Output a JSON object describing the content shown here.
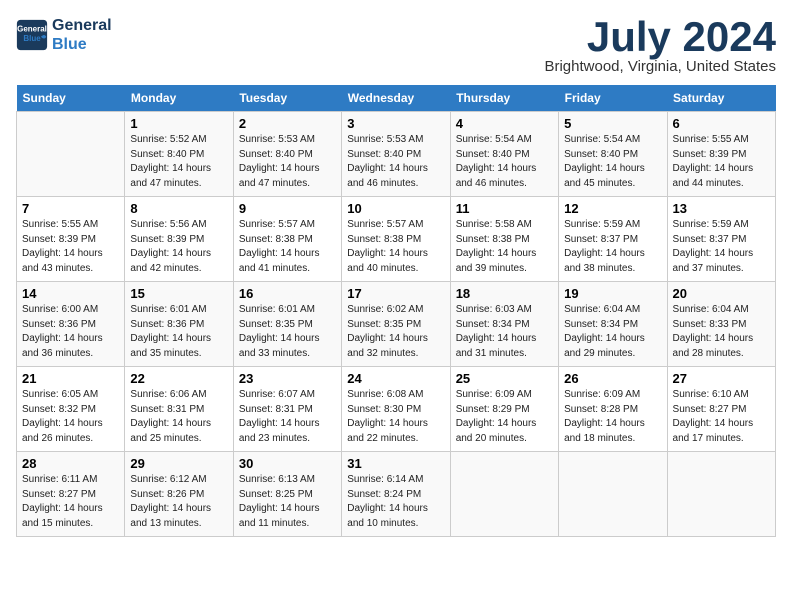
{
  "logo": {
    "line1": "General",
    "line2": "Blue"
  },
  "title": "July 2024",
  "location": "Brightwood, Virginia, United States",
  "days_header": [
    "Sunday",
    "Monday",
    "Tuesday",
    "Wednesday",
    "Thursday",
    "Friday",
    "Saturday"
  ],
  "weeks": [
    [
      {
        "num": "",
        "info": ""
      },
      {
        "num": "1",
        "info": "Sunrise: 5:52 AM\nSunset: 8:40 PM\nDaylight: 14 hours\nand 47 minutes."
      },
      {
        "num": "2",
        "info": "Sunrise: 5:53 AM\nSunset: 8:40 PM\nDaylight: 14 hours\nand 47 minutes."
      },
      {
        "num": "3",
        "info": "Sunrise: 5:53 AM\nSunset: 8:40 PM\nDaylight: 14 hours\nand 46 minutes."
      },
      {
        "num": "4",
        "info": "Sunrise: 5:54 AM\nSunset: 8:40 PM\nDaylight: 14 hours\nand 46 minutes."
      },
      {
        "num": "5",
        "info": "Sunrise: 5:54 AM\nSunset: 8:40 PM\nDaylight: 14 hours\nand 45 minutes."
      },
      {
        "num": "6",
        "info": "Sunrise: 5:55 AM\nSunset: 8:39 PM\nDaylight: 14 hours\nand 44 minutes."
      }
    ],
    [
      {
        "num": "7",
        "info": "Sunrise: 5:55 AM\nSunset: 8:39 PM\nDaylight: 14 hours\nand 43 minutes."
      },
      {
        "num": "8",
        "info": "Sunrise: 5:56 AM\nSunset: 8:39 PM\nDaylight: 14 hours\nand 42 minutes."
      },
      {
        "num": "9",
        "info": "Sunrise: 5:57 AM\nSunset: 8:38 PM\nDaylight: 14 hours\nand 41 minutes."
      },
      {
        "num": "10",
        "info": "Sunrise: 5:57 AM\nSunset: 8:38 PM\nDaylight: 14 hours\nand 40 minutes."
      },
      {
        "num": "11",
        "info": "Sunrise: 5:58 AM\nSunset: 8:38 PM\nDaylight: 14 hours\nand 39 minutes."
      },
      {
        "num": "12",
        "info": "Sunrise: 5:59 AM\nSunset: 8:37 PM\nDaylight: 14 hours\nand 38 minutes."
      },
      {
        "num": "13",
        "info": "Sunrise: 5:59 AM\nSunset: 8:37 PM\nDaylight: 14 hours\nand 37 minutes."
      }
    ],
    [
      {
        "num": "14",
        "info": "Sunrise: 6:00 AM\nSunset: 8:36 PM\nDaylight: 14 hours\nand 36 minutes."
      },
      {
        "num": "15",
        "info": "Sunrise: 6:01 AM\nSunset: 8:36 PM\nDaylight: 14 hours\nand 35 minutes."
      },
      {
        "num": "16",
        "info": "Sunrise: 6:01 AM\nSunset: 8:35 PM\nDaylight: 14 hours\nand 33 minutes."
      },
      {
        "num": "17",
        "info": "Sunrise: 6:02 AM\nSunset: 8:35 PM\nDaylight: 14 hours\nand 32 minutes."
      },
      {
        "num": "18",
        "info": "Sunrise: 6:03 AM\nSunset: 8:34 PM\nDaylight: 14 hours\nand 31 minutes."
      },
      {
        "num": "19",
        "info": "Sunrise: 6:04 AM\nSunset: 8:34 PM\nDaylight: 14 hours\nand 29 minutes."
      },
      {
        "num": "20",
        "info": "Sunrise: 6:04 AM\nSunset: 8:33 PM\nDaylight: 14 hours\nand 28 minutes."
      }
    ],
    [
      {
        "num": "21",
        "info": "Sunrise: 6:05 AM\nSunset: 8:32 PM\nDaylight: 14 hours\nand 26 minutes."
      },
      {
        "num": "22",
        "info": "Sunrise: 6:06 AM\nSunset: 8:31 PM\nDaylight: 14 hours\nand 25 minutes."
      },
      {
        "num": "23",
        "info": "Sunrise: 6:07 AM\nSunset: 8:31 PM\nDaylight: 14 hours\nand 23 minutes."
      },
      {
        "num": "24",
        "info": "Sunrise: 6:08 AM\nSunset: 8:30 PM\nDaylight: 14 hours\nand 22 minutes."
      },
      {
        "num": "25",
        "info": "Sunrise: 6:09 AM\nSunset: 8:29 PM\nDaylight: 14 hours\nand 20 minutes."
      },
      {
        "num": "26",
        "info": "Sunrise: 6:09 AM\nSunset: 8:28 PM\nDaylight: 14 hours\nand 18 minutes."
      },
      {
        "num": "27",
        "info": "Sunrise: 6:10 AM\nSunset: 8:27 PM\nDaylight: 14 hours\nand 17 minutes."
      }
    ],
    [
      {
        "num": "28",
        "info": "Sunrise: 6:11 AM\nSunset: 8:27 PM\nDaylight: 14 hours\nand 15 minutes."
      },
      {
        "num": "29",
        "info": "Sunrise: 6:12 AM\nSunset: 8:26 PM\nDaylight: 14 hours\nand 13 minutes."
      },
      {
        "num": "30",
        "info": "Sunrise: 6:13 AM\nSunset: 8:25 PM\nDaylight: 14 hours\nand 11 minutes."
      },
      {
        "num": "31",
        "info": "Sunrise: 6:14 AM\nSunset: 8:24 PM\nDaylight: 14 hours\nand 10 minutes."
      },
      {
        "num": "",
        "info": ""
      },
      {
        "num": "",
        "info": ""
      },
      {
        "num": "",
        "info": ""
      }
    ]
  ]
}
